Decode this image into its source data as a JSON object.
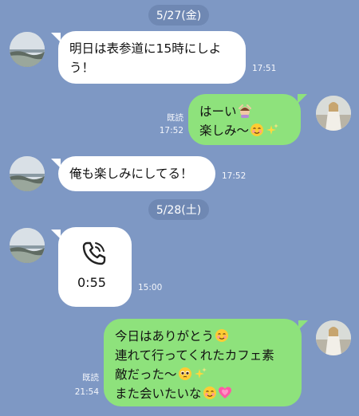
{
  "dates": [
    "5/27(金)",
    "5/28(土)"
  ],
  "messages": [
    {
      "from": "other",
      "lines": [
        "明日は表参道に15時にしよ",
        "う！"
      ],
      "time": "17:51"
    },
    {
      "from": "me",
      "lines": [
        "はーい",
        "楽しみ〜"
      ],
      "read": "既読",
      "time": "17:52"
    },
    {
      "from": "other",
      "lines": [
        "俺も楽しみにしてる！"
      ],
      "time": "17:52"
    },
    {
      "from": "other",
      "type": "call",
      "icon": "phone-call-icon",
      "duration": "0:55",
      "time": "15:00"
    },
    {
      "from": "me",
      "lines": [
        "今日はありがとう",
        "連れて行ってくれたカフェ素",
        "敵だった〜",
        "また会いたいな"
      ],
      "read": "既読",
      "time": "21:54"
    }
  ],
  "colors": {
    "background": "#7e98c4",
    "incoming": "#ffffff",
    "outgoing": "#8ee27c",
    "date_pill": "#6f88b3"
  }
}
